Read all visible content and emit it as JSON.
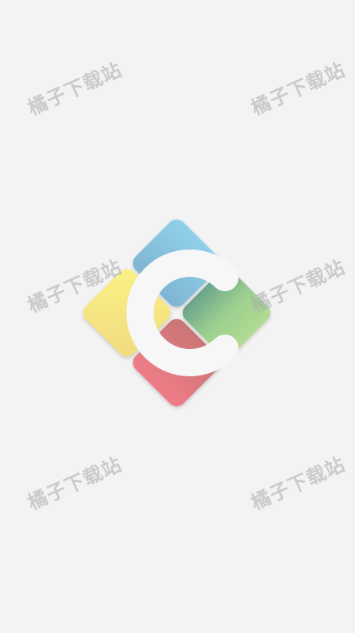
{
  "app": {
    "logo_icon": "app-logo-c-icon",
    "background_color": "#f3f3f3",
    "logo_colors": {
      "blue": "#8fc9e4",
      "yellow": "#f7ef86",
      "green": "#a9d88e",
      "red": "#ee7d86",
      "letter": "#f7f7f7"
    }
  },
  "watermarks": [
    "橘子下载站",
    "橘子下载站",
    "橘子下载站",
    "橘子下载站",
    "橘子下载站",
    "橘子下载站"
  ]
}
